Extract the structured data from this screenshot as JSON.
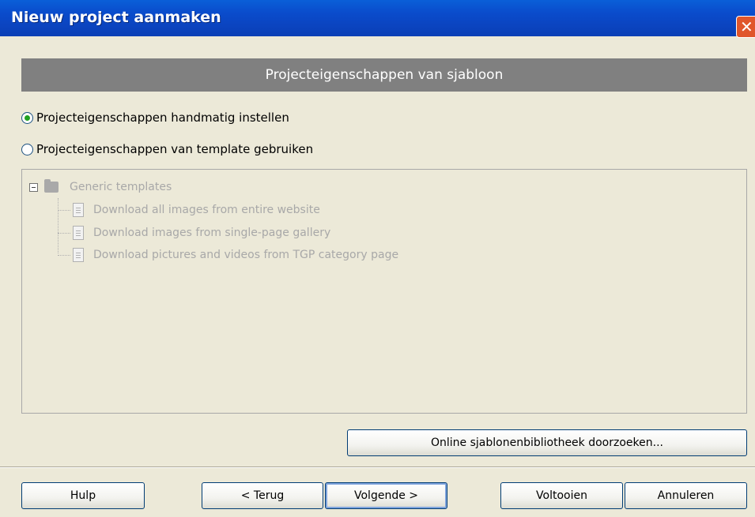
{
  "window": {
    "title": "Nieuw project aanmaken",
    "close_glyph": "✕"
  },
  "header": {
    "title": "Projecteigenschappen van sjabloon"
  },
  "options": {
    "manual": {
      "label": "Projecteigenschappen handmatig instellen",
      "checked": true
    },
    "template": {
      "label": "Projecteigenschappen van template gebruiken",
      "checked": false
    }
  },
  "tree": {
    "root": {
      "label": "Generic templates",
      "icon": "folder-icon",
      "expanded": true
    },
    "items": [
      {
        "label": "Download all images from entire website",
        "icon": "template-doc-icon"
      },
      {
        "label": "Download images from single-page gallery",
        "icon": "template-doc-icon"
      },
      {
        "label": "Download pictures and videos from TGP category page",
        "icon": "template-doc-icon"
      }
    ],
    "disabled": true
  },
  "buttons": {
    "browse_online": "Online sjablonenbibliotheek doorzoeken...",
    "help": "Hulp",
    "back": "< Terug",
    "next": "Volgende >",
    "finish": "Voltooien",
    "cancel": "Annuleren"
  },
  "colors": {
    "titlebar": "#0a4ccc",
    "header_bg": "#808080",
    "disabled_text": "#a8a8a8",
    "dialog_bg": "#ece9d8"
  }
}
